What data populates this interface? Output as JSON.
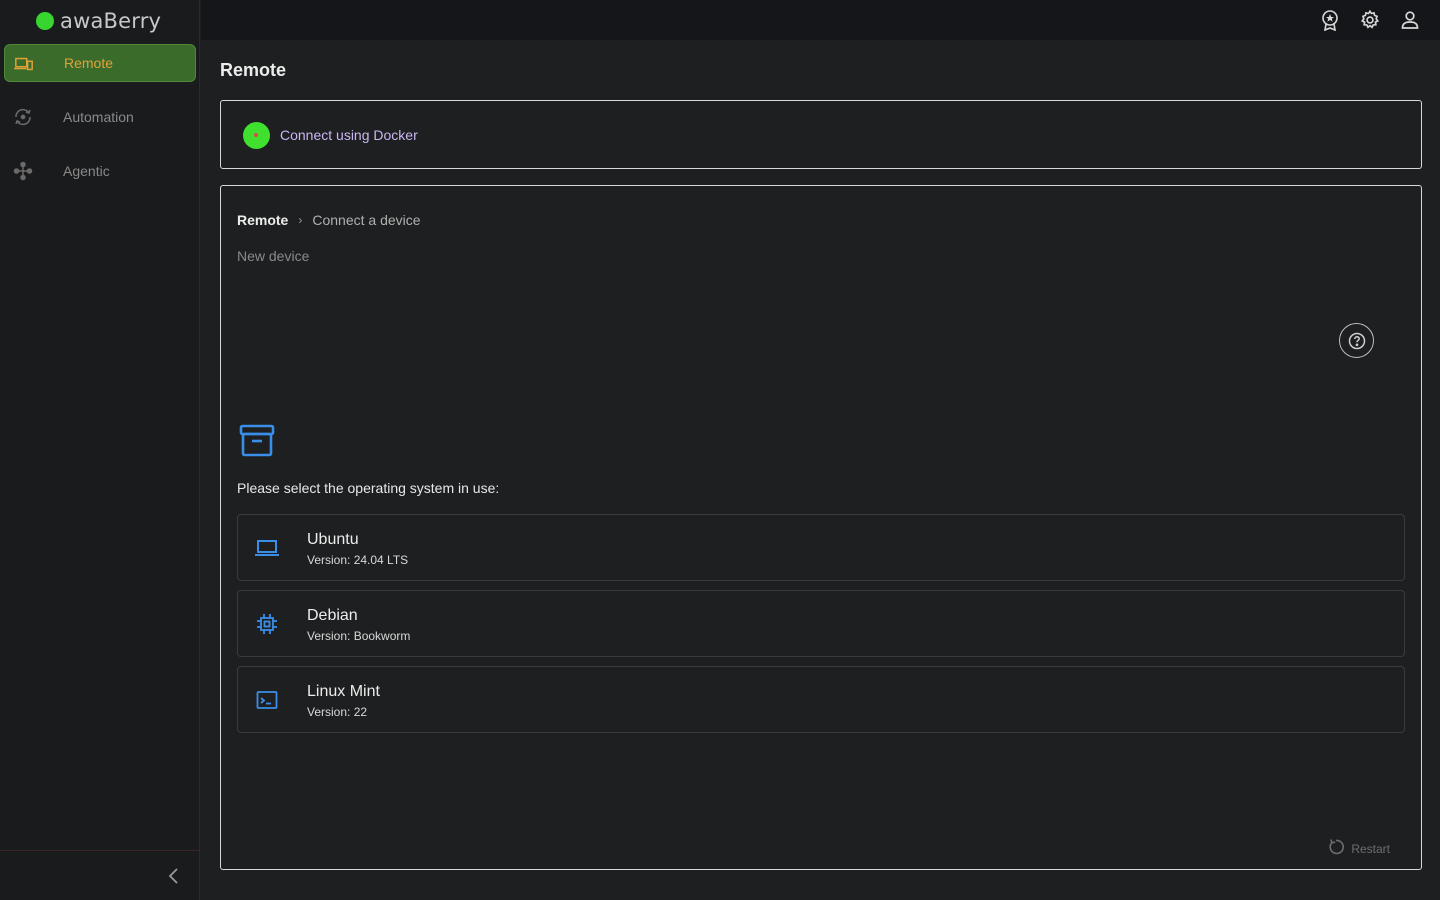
{
  "app": {
    "name": "awaBerry",
    "brand_color": "#38d430"
  },
  "sidebar": {
    "items": [
      {
        "label": "Remote",
        "icon": "devices-icon",
        "active": true
      },
      {
        "label": "Automation",
        "icon": "automation-icon",
        "active": false
      },
      {
        "label": "Agentic",
        "icon": "agentic-icon",
        "active": false
      }
    ],
    "collapse_icon": "chevron-left-icon"
  },
  "topbar": {
    "icons": [
      "award-icon",
      "gear-icon",
      "user-icon"
    ]
  },
  "main": {
    "title": "Remote",
    "docker": {
      "label": "Connect using Docker",
      "status_color": "#3fe12e"
    },
    "wizard": {
      "breadcrumb": {
        "root": "Remote",
        "separator": "›",
        "current": "Connect a device"
      },
      "subtitle": "New device",
      "prompt": "Please select the operating system in use:",
      "os_options": [
        {
          "name": "Ubuntu",
          "version": "Version: 24.04 LTS",
          "icon": "laptop-icon"
        },
        {
          "name": "Debian",
          "version": "Version: Bookworm",
          "icon": "chip-icon"
        },
        {
          "name": "Linux Mint",
          "version": "Version: 22",
          "icon": "terminal-icon"
        }
      ],
      "restart_label": "Restart"
    }
  }
}
